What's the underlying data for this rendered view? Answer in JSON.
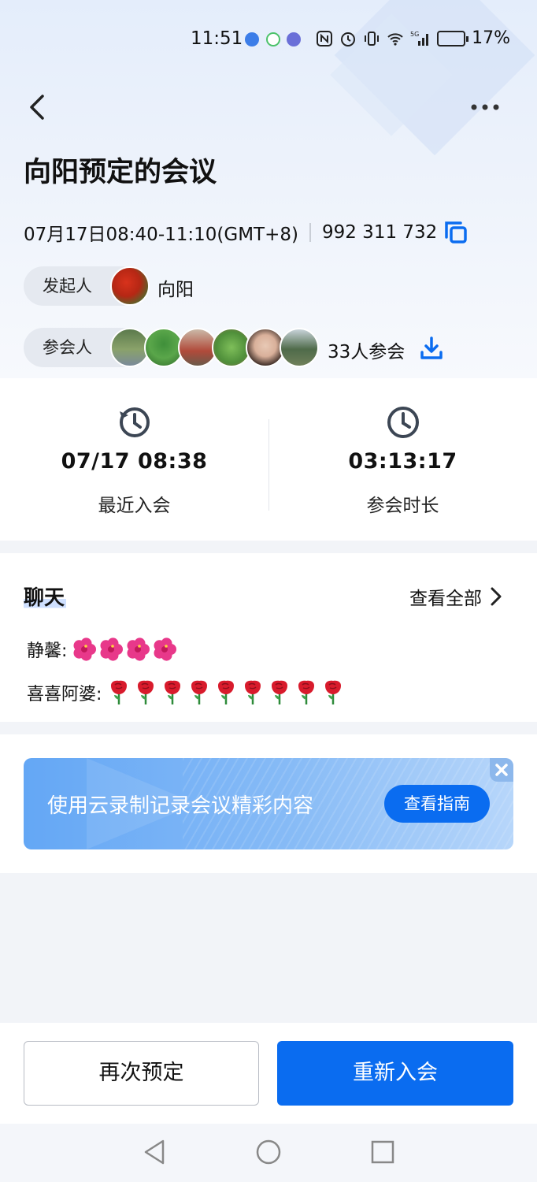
{
  "status_bar": {
    "time": "11:51",
    "network": "5G",
    "battery_percent": "17%"
  },
  "header": {
    "back_icon": "chevron-left-icon",
    "more_icon": "more-dots-icon"
  },
  "meeting": {
    "title": "向阳预定的会议",
    "datetime": "07月17日08:40-11:10(GMT+8)",
    "meeting_id": "992 311 732",
    "initiator_label": "发起人",
    "initiator_name": "向阳",
    "attendees_label": "参会人",
    "attendees_count": "33人参会"
  },
  "stats": {
    "recent_join_value": "07/17 08:38",
    "recent_join_label": "最近入会",
    "duration_value": "03:13:17",
    "duration_label": "参会时长"
  },
  "chat": {
    "title": "聊天",
    "view_all": "查看全部",
    "messages": [
      {
        "sender": "静馨:",
        "emoji": "hibiscus",
        "count": 4
      },
      {
        "sender": "喜喜阿婆:",
        "emoji": "rose",
        "count": 9
      }
    ]
  },
  "banner": {
    "text": "使用云录制记录会议精彩内容",
    "button": "查看指南"
  },
  "actions": {
    "reschedule": "再次预定",
    "rejoin": "重新入会"
  },
  "colors": {
    "primary": "#0a6cf0",
    "background": "#f2f4f8"
  }
}
